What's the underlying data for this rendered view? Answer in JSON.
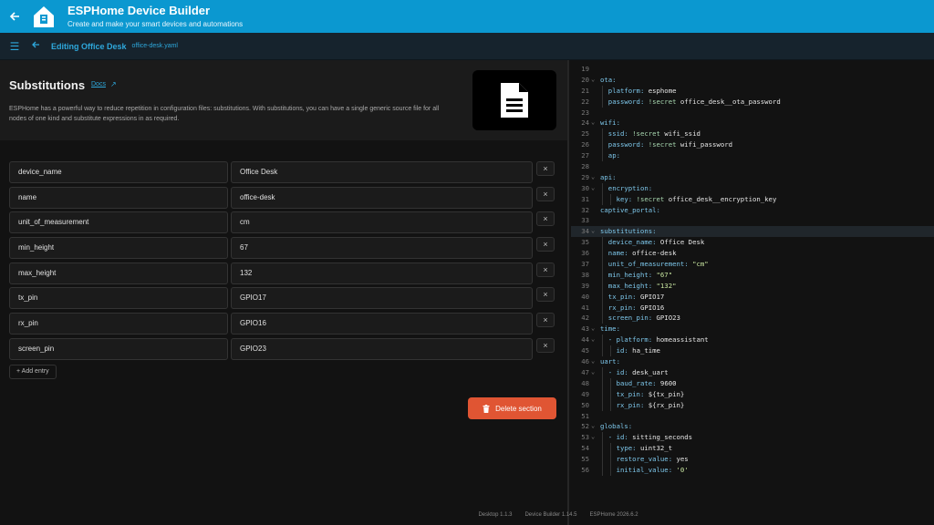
{
  "header": {
    "title": "ESPHome Device Builder",
    "subtitle": "Create and make your smart devices and automations"
  },
  "subbar": {
    "editing_title": "Editing Office Desk",
    "file_name": "office-desk.yaml"
  },
  "section": {
    "title": "Substitutions",
    "docs_label": "Docs",
    "description": "ESPHome has a powerful way to reduce repetition in configuration files: substitutions. With substitutions, you can have a single generic source file for all nodes of one kind and substitute expressions in as required.",
    "entries": [
      {
        "key": "device_name",
        "value": "Office Desk"
      },
      {
        "key": "name",
        "value": "office-desk"
      },
      {
        "key": "unit_of_measurement",
        "value": "cm"
      },
      {
        "key": "min_height",
        "value": "67"
      },
      {
        "key": "max_height",
        "value": "132"
      },
      {
        "key": "tx_pin",
        "value": "GPIO17"
      },
      {
        "key": "rx_pin",
        "value": "GPIO16"
      },
      {
        "key": "screen_pin",
        "value": "GPIO23"
      }
    ],
    "remove_symbol": "×",
    "add_entry_label": "+ Add entry",
    "delete_label": "Delete section"
  },
  "editor": {
    "highlight_line": 34,
    "lines": [
      {
        "n": 19,
        "indent": 0,
        "fold": false,
        "parts": []
      },
      {
        "n": 20,
        "indent": 0,
        "fold": true,
        "parts": [
          {
            "t": "ota:",
            "c": "k"
          }
        ]
      },
      {
        "n": 21,
        "indent": 1,
        "fold": false,
        "parts": [
          {
            "t": "platform: ",
            "c": "k"
          },
          {
            "t": "esphome",
            "c": ""
          }
        ]
      },
      {
        "n": 22,
        "indent": 1,
        "fold": false,
        "parts": [
          {
            "t": "password: ",
            "c": "k"
          },
          {
            "t": "!secret ",
            "c": "t"
          },
          {
            "t": "office_desk__ota_password",
            "c": ""
          }
        ]
      },
      {
        "n": 23,
        "indent": 0,
        "fold": false,
        "parts": []
      },
      {
        "n": 24,
        "indent": 0,
        "fold": true,
        "parts": [
          {
            "t": "wifi:",
            "c": "k"
          }
        ]
      },
      {
        "n": 25,
        "indent": 1,
        "fold": false,
        "parts": [
          {
            "t": "ssid: ",
            "c": "k"
          },
          {
            "t": "!secret ",
            "c": "t"
          },
          {
            "t": "wifi_ssid",
            "c": ""
          }
        ]
      },
      {
        "n": 26,
        "indent": 1,
        "fold": false,
        "parts": [
          {
            "t": "password: ",
            "c": "k"
          },
          {
            "t": "!secret ",
            "c": "t"
          },
          {
            "t": "wifi_password",
            "c": ""
          }
        ]
      },
      {
        "n": 27,
        "indent": 1,
        "fold": false,
        "parts": [
          {
            "t": "ap:",
            "c": "k"
          }
        ]
      },
      {
        "n": 28,
        "indent": 0,
        "fold": false,
        "parts": []
      },
      {
        "n": 29,
        "indent": 0,
        "fold": true,
        "parts": [
          {
            "t": "api:",
            "c": "k"
          }
        ]
      },
      {
        "n": 30,
        "indent": 1,
        "fold": true,
        "parts": [
          {
            "t": "encryption:",
            "c": "k"
          }
        ]
      },
      {
        "n": 31,
        "indent": 2,
        "fold": false,
        "parts": [
          {
            "t": "key: ",
            "c": "k"
          },
          {
            "t": "!secret ",
            "c": "t"
          },
          {
            "t": "office_desk__encryption_key",
            "c": ""
          }
        ]
      },
      {
        "n": 32,
        "indent": 0,
        "fold": false,
        "parts": [
          {
            "t": "captive_portal:",
            "c": "k"
          }
        ]
      },
      {
        "n": 33,
        "indent": 0,
        "fold": false,
        "parts": []
      },
      {
        "n": 34,
        "indent": 0,
        "fold": true,
        "parts": [
          {
            "t": "substitutions:",
            "c": "k"
          }
        ]
      },
      {
        "n": 35,
        "indent": 1,
        "fold": false,
        "parts": [
          {
            "t": "device_name: ",
            "c": "k"
          },
          {
            "t": "Office Desk",
            "c": ""
          }
        ]
      },
      {
        "n": 36,
        "indent": 1,
        "fold": false,
        "parts": [
          {
            "t": "name: ",
            "c": "k"
          },
          {
            "t": "office-desk",
            "c": ""
          }
        ]
      },
      {
        "n": 37,
        "indent": 1,
        "fold": false,
        "parts": [
          {
            "t": "unit_of_measurement: ",
            "c": "k"
          },
          {
            "t": "\"cm\"",
            "c": "s"
          }
        ]
      },
      {
        "n": 38,
        "indent": 1,
        "fold": false,
        "parts": [
          {
            "t": "min_height: ",
            "c": "k"
          },
          {
            "t": "\"67\"",
            "c": "s"
          }
        ]
      },
      {
        "n": 39,
        "indent": 1,
        "fold": false,
        "parts": [
          {
            "t": "max_height: ",
            "c": "k"
          },
          {
            "t": "\"132\"",
            "c": "s"
          }
        ]
      },
      {
        "n": 40,
        "indent": 1,
        "fold": false,
        "parts": [
          {
            "t": "tx_pin: ",
            "c": "k"
          },
          {
            "t": "GPIO17",
            "c": ""
          }
        ]
      },
      {
        "n": 41,
        "indent": 1,
        "fold": false,
        "parts": [
          {
            "t": "rx_pin: ",
            "c": "k"
          },
          {
            "t": "GPIO16",
            "c": ""
          }
        ]
      },
      {
        "n": 42,
        "indent": 1,
        "fold": false,
        "parts": [
          {
            "t": "screen_pin: ",
            "c": "k"
          },
          {
            "t": "GPIO23",
            "c": ""
          }
        ]
      },
      {
        "n": 43,
        "indent": 0,
        "fold": true,
        "parts": [
          {
            "t": "time:",
            "c": "k"
          }
        ]
      },
      {
        "n": 44,
        "indent": 1,
        "fold": true,
        "parts": [
          {
            "t": "- platform: ",
            "c": "k"
          },
          {
            "t": "homeassistant",
            "c": ""
          }
        ]
      },
      {
        "n": 45,
        "indent": 2,
        "fold": false,
        "parts": [
          {
            "t": "id: ",
            "c": "k"
          },
          {
            "t": "ha_time",
            "c": ""
          }
        ]
      },
      {
        "n": 46,
        "indent": 0,
        "fold": true,
        "parts": [
          {
            "t": "uart:",
            "c": "k"
          }
        ]
      },
      {
        "n": 47,
        "indent": 1,
        "fold": true,
        "parts": [
          {
            "t": "- id: ",
            "c": "k"
          },
          {
            "t": "desk_uart",
            "c": ""
          }
        ]
      },
      {
        "n": 48,
        "indent": 2,
        "fold": false,
        "parts": [
          {
            "t": "baud_rate: ",
            "c": "k"
          },
          {
            "t": "9600",
            "c": ""
          }
        ]
      },
      {
        "n": 49,
        "indent": 2,
        "fold": false,
        "parts": [
          {
            "t": "tx_pin: ",
            "c": "k"
          },
          {
            "t": "${tx_pin}",
            "c": ""
          }
        ]
      },
      {
        "n": 50,
        "indent": 2,
        "fold": false,
        "parts": [
          {
            "t": "rx_pin: ",
            "c": "k"
          },
          {
            "t": "${rx_pin}",
            "c": ""
          }
        ]
      },
      {
        "n": 51,
        "indent": 0,
        "fold": false,
        "parts": []
      },
      {
        "n": 52,
        "indent": 0,
        "fold": true,
        "parts": [
          {
            "t": "globals:",
            "c": "k"
          }
        ]
      },
      {
        "n": 53,
        "indent": 1,
        "fold": true,
        "parts": [
          {
            "t": "- id: ",
            "c": "k"
          },
          {
            "t": "sitting_seconds",
            "c": ""
          }
        ]
      },
      {
        "n": 54,
        "indent": 2,
        "fold": false,
        "parts": [
          {
            "t": "type: ",
            "c": "k"
          },
          {
            "t": "uint32_t",
            "c": ""
          }
        ]
      },
      {
        "n": 55,
        "indent": 2,
        "fold": false,
        "parts": [
          {
            "t": "restore_value: ",
            "c": "k"
          },
          {
            "t": "yes",
            "c": ""
          }
        ]
      },
      {
        "n": 56,
        "indent": 2,
        "fold": false,
        "parts": [
          {
            "t": "initial_value: ",
            "c": "k"
          },
          {
            "t": "'0'",
            "c": "s"
          }
        ]
      }
    ]
  },
  "footer": {
    "desktop_version": "Desktop 1.1.3",
    "builder_version": "Device Builder 1.14.5",
    "esphome_version": "ESPHome 2026.6.2"
  },
  "colors": {
    "brand": "#0b98d0",
    "accent": "#2ea8dc",
    "danger": "#e05533"
  }
}
